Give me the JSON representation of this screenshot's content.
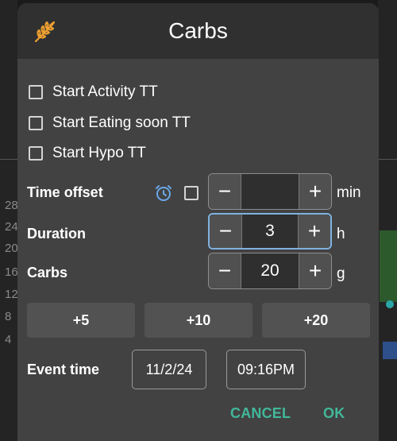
{
  "background": {
    "axis_values": [
      "28",
      "24",
      "20",
      "16",
      "12",
      "8",
      "4"
    ]
  },
  "dialog": {
    "title": "Carbs",
    "header_icon": "wheat-icon",
    "checkboxes": [
      {
        "label": "Start Activity TT",
        "checked": false
      },
      {
        "label": "Start Eating soon TT",
        "checked": false
      },
      {
        "label": "Start Hypo TT",
        "checked": false
      }
    ],
    "time_offset": {
      "label": "Time offset",
      "icon": "alarm-clock-icon",
      "checked": false,
      "value": "",
      "unit": "min",
      "minus": "−",
      "plus": "+"
    },
    "duration": {
      "label": "Duration",
      "value": "3",
      "unit": "h",
      "minus": "−",
      "plus": "+"
    },
    "carbs": {
      "label": "Carbs",
      "value": "20",
      "unit": "g",
      "minus": "−",
      "plus": "+"
    },
    "quick_add": [
      "+5",
      "+10",
      "+20"
    ],
    "event_time": {
      "label": "Event time",
      "date": "11/2/24",
      "time": "09:16PM"
    },
    "cancel_label": "CANCEL",
    "ok_label": "OK",
    "colors": {
      "accent": "#41b89a",
      "icon_orange": "#f0a030",
      "icon_blue": "#6aa8e8",
      "focus_border": "#7fb2e0"
    }
  }
}
